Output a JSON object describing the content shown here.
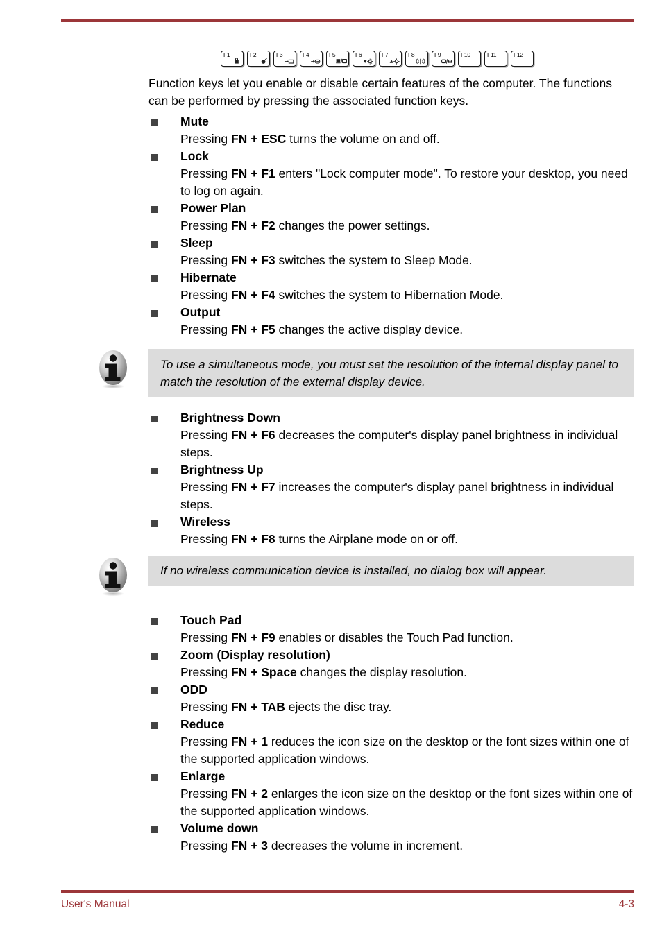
{
  "document": {
    "footer": {
      "manual_label": "User's Manual",
      "page_number": "4-3"
    },
    "rule_color": "#9c3639"
  },
  "keystrip": {
    "name": "function-key-row",
    "keys": [
      {
        "label": "F1",
        "glyph": "lock-icon"
      },
      {
        "label": "F2",
        "glyph": "power-plan-icon"
      },
      {
        "label": "F3",
        "glyph": "sleep-icon"
      },
      {
        "label": "F4",
        "glyph": "hibernate-icon"
      },
      {
        "label": "F5",
        "glyph": "output-display-icon"
      },
      {
        "label": "F6",
        "glyph": "brightness-down-icon"
      },
      {
        "label": "F7",
        "glyph": "brightness-up-icon"
      },
      {
        "label": "F8",
        "glyph": "wireless-icon"
      },
      {
        "label": "F9",
        "glyph": "touch-pad-icon"
      },
      {
        "label": "F10",
        "glyph": ""
      },
      {
        "label": "F11",
        "glyph": ""
      },
      {
        "label": "F12",
        "glyph": ""
      }
    ]
  },
  "intro": {
    "line1": "Function keys let you enable or disable certain features of the computer.",
    "line2": "The functions can be performed by pressing the associated function keys.",
    "text": "Function keys let you enable or disable certain features of the computer. The functions can be performed by pressing the associated function keys."
  },
  "groups": {
    "group_a": [
      {
        "title": "Mute",
        "desc_pre": "Pressing ",
        "desc_key": "FN + ESC",
        "desc_post": " turns the volume on and off."
      },
      {
        "title": "Lock",
        "desc_pre": "Pressing ",
        "desc_key": "FN + F1",
        "desc_post": " enters \"Lock computer mode\". To restore your desktop, you need to log on again."
      },
      {
        "title": "Power Plan",
        "desc_pre": "Pressing ",
        "desc_key": "FN + F2",
        "desc_post": " changes the power settings."
      },
      {
        "title": "Sleep",
        "desc_pre": "Pressing ",
        "desc_key": "FN + F3",
        "desc_post": " switches the system to Sleep Mode."
      },
      {
        "title": "Hibernate",
        "desc_pre": "Pressing ",
        "desc_key": "FN + F4",
        "desc_post": " switches the system to Hibernation Mode."
      },
      {
        "title": "Output",
        "desc_pre": "Pressing ",
        "desc_key": "FN + F5",
        "desc_post": " changes the active display device."
      }
    ],
    "group_b": [
      {
        "title": "Brightness Down",
        "desc_pre": "Pressing ",
        "desc_key": "FN + F6",
        "desc_post": " decreases the computer's display panel brightness in individual steps."
      },
      {
        "title": "Brightness Up",
        "desc_pre": "Pressing ",
        "desc_key": "FN + F7",
        "desc_post": " increases the computer's display panel brightness in individual steps."
      },
      {
        "title": "Wireless",
        "desc_pre": "Pressing ",
        "desc_key": "FN + F8",
        "desc_post": " turns the Airplane mode on or off."
      }
    ],
    "group_c": [
      {
        "title": "Touch Pad",
        "desc_pre": "Pressing ",
        "desc_key": "FN + F9",
        "desc_post": " enables or disables the Touch Pad function."
      },
      {
        "title": "Zoom (Display resolution)",
        "desc_pre": "Pressing ",
        "desc_key": "FN + Space",
        "desc_post": " changes the display resolution."
      },
      {
        "title": "ODD",
        "desc_pre": "Pressing ",
        "desc_key": "FN + TAB",
        "desc_post": " ejects the disc tray."
      },
      {
        "title": "Reduce",
        "desc_pre": "Pressing ",
        "desc_key": "FN + 1",
        "desc_post": " reduces the icon size on the desktop or the font sizes within one of the supported application windows."
      },
      {
        "title": "Enlarge",
        "desc_pre": "Pressing ",
        "desc_key": "FN + 2",
        "desc_post": " enlarges the icon size on the desktop or the font sizes within one of the supported application windows."
      },
      {
        "title": "Volume down",
        "desc_pre": "Pressing ",
        "desc_key": "FN + 3",
        "desc_post": " decreases the volume in increment."
      }
    ]
  },
  "notes": {
    "note_a": {
      "icon": "info-icon",
      "text": "To use a simultaneous mode, you must set the resolution of the internal display panel to match the resolution of the external display device."
    },
    "note_b": {
      "icon": "info-icon",
      "text": "If no wireless communication device is installed, no dialog box will appear."
    }
  }
}
